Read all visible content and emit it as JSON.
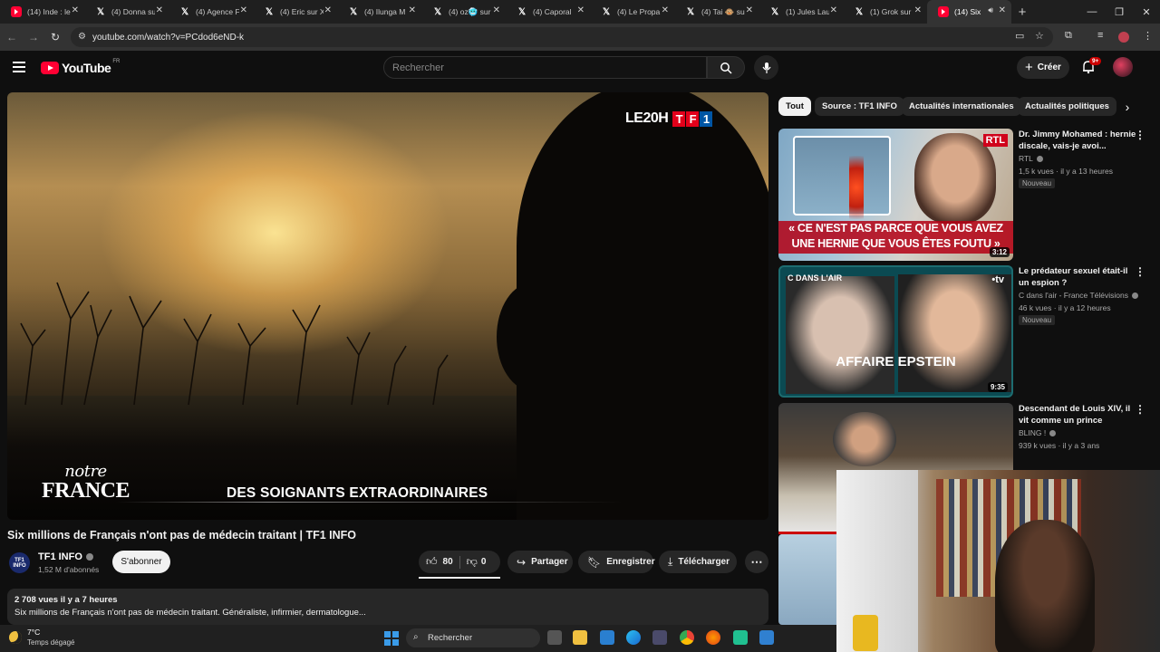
{
  "browser": {
    "tabs": [
      {
        "label": "(14) Inde : le",
        "kind": "yt"
      },
      {
        "label": "(4) Donna su",
        "kind": "x"
      },
      {
        "label": "(4) Agence F",
        "kind": "x"
      },
      {
        "label": "(4) Eric sur X",
        "kind": "x"
      },
      {
        "label": "(4) Ilunga M",
        "kind": "x"
      },
      {
        "label": "(4) oz🥶 sur",
        "kind": "x"
      },
      {
        "label": "(4) Caporal",
        "kind": "x"
      },
      {
        "label": "(4) Le Propa",
        "kind": "x"
      },
      {
        "label": "(4) Tai 🐵 sur",
        "kind": "x"
      },
      {
        "label": "(1) Jules Lau",
        "kind": "x"
      },
      {
        "label": "(1) Grok sur",
        "kind": "x"
      },
      {
        "label": "(14) Six",
        "kind": "yt",
        "active": true
      }
    ],
    "url": "youtube.com/watch?v=PCdod6eND-k"
  },
  "header": {
    "logo_text": "YouTube",
    "country_code": "FR",
    "search_placeholder": "Rechercher",
    "create_label": "Créer",
    "notifications_badge": "9+"
  },
  "player": {
    "brand_prefix": "LE20H",
    "brand_letters": [
      "T",
      "F",
      "1"
    ],
    "show_line1": "notre",
    "show_line2": "FRANCE",
    "lower_third": "DES SOIGNANTS EXTRAORDINAIRES"
  },
  "video": {
    "title": "Six millions de Français n'ont pas de médecin traitant | TF1 INFO",
    "channel_name": "TF1 INFO",
    "channel_avatar_text": "TF1 INFO",
    "subscribers": "1,52 M d'abonnés",
    "subscribe_label": "S'abonner",
    "likes": "80",
    "dislikes": "0",
    "share_label": "Partager",
    "save_label": "Enregistrer",
    "download_label": "Télécharger",
    "views_date": "2 708 vues  il y a 7 heures",
    "description": "Six millions de Français n'ont pas de médecin traitant. Généraliste, infirmier, dermatologue..."
  },
  "chips": [
    "Tout",
    "Source : TF1 INFO",
    "Actualités internationales",
    "Actualités politiques"
  ],
  "recommendations": [
    {
      "title": "Dr. Jimmy Mohamed : hernie discale, vais-je avoi...",
      "channel": "RTL",
      "meta": "1,5 k vues · il y a 13 heures",
      "badge": "Nouveau",
      "duration": "3:12",
      "overlay_text": "« CE N'EST PAS PARCE QUE VOUS AVEZ UNE HERNIE QUE VOUS ÊTES FOUTU »",
      "logo_text": "RTL"
    },
    {
      "title": "Le prédateur sexuel était-il un espion ?",
      "channel": "C dans l'air - France Télévisions",
      "meta": "46 k vues · il y a 12 heures",
      "badge": "Nouveau",
      "duration": "9:35",
      "overlay_text": "AFFAIRE EPSTEIN",
      "logo_text": "C DANS L'AIR",
      "corner_text": "•tv"
    },
    {
      "title": "Descendant de Louis XIV, il vit comme un prince",
      "channel": "BLING !",
      "meta": "939 k vues · il y a 3 ans"
    }
  ],
  "taskbar": {
    "temperature": "7°C",
    "weather": "Temps dégagé",
    "search_label": "Rechercher"
  }
}
